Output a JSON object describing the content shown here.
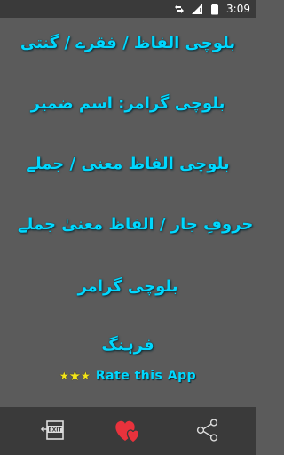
{
  "status_bar": {
    "time": "3:09",
    "icons": [
      "data-transfer-icon",
      "signal-icon",
      "battery-icon"
    ]
  },
  "menu": {
    "items": [
      {
        "label": "بلوچی الفاظ / فقرے / گنتی"
      },
      {
        "label": "بلوچی گرامر: اسم ضمیر"
      },
      {
        "label": "بلوچی الفاظ معنی / جملے"
      },
      {
        "label": "حروفِ جار / الفاظ معنیٰ جملے"
      },
      {
        "label": "بلوچی گرامر"
      },
      {
        "label": "فرہنگ"
      }
    ]
  },
  "rate": {
    "label": "Rate this App",
    "icon": "three-stars-icon"
  },
  "bottom_bar": {
    "buttons": [
      {
        "name": "exit-icon",
        "text": "EXIT"
      },
      {
        "name": "hearts-icon"
      },
      {
        "name": "share-icon"
      }
    ]
  },
  "colors": {
    "background": "#5b5b5b",
    "bar": "#3a3a3a",
    "accent": "#00d8ff",
    "heart": "#e8323c",
    "star": "#f2e41a"
  }
}
